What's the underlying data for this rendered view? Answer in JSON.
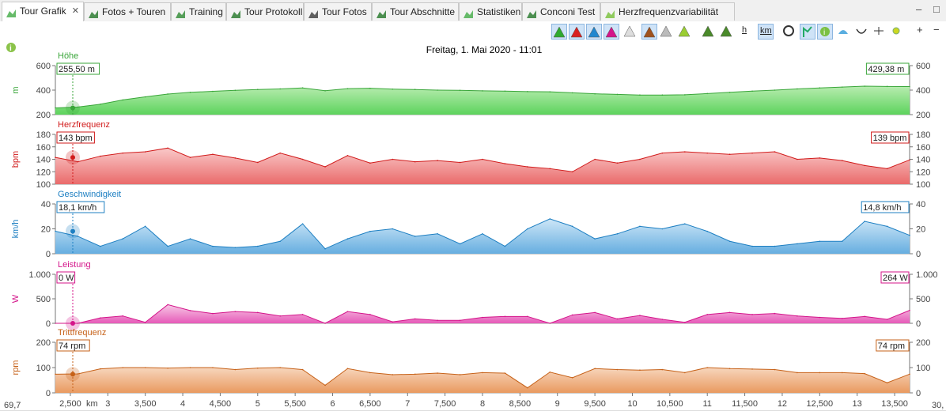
{
  "tabs": [
    {
      "label": "Tour Grafik",
      "icon": "chart-area-icon",
      "active": true,
      "closable": true
    },
    {
      "label": "Fotos + Touren",
      "icon": "photo-tour-icon"
    },
    {
      "label": "Training",
      "icon": "training-icon"
    },
    {
      "label": "Tour Protokoll",
      "icon": "protocol-icon"
    },
    {
      "label": "Tour Fotos",
      "icon": "camera-icon"
    },
    {
      "label": "Tour Abschnitte",
      "icon": "segments-icon"
    },
    {
      "label": "Statistiken",
      "icon": "statistics-icon"
    },
    {
      "label": "Conconi Test",
      "icon": "conconi-icon"
    },
    {
      "label": "Herzfrequenzvariabilität",
      "icon": "heart-icon"
    }
  ],
  "window_controls": {
    "minimize": "–",
    "maximize": "□"
  },
  "toolbar": {
    "plus": "+",
    "minus": "−",
    "tb_h": "h",
    "tb_km": "km"
  },
  "graph": {
    "title": "Freitag, 1. Mai 2020 - 11:01",
    "x_left_value": "69,7",
    "x_right_value": "30,",
    "x_unit": "km",
    "x_ticks": [
      "2,500",
      "3",
      "3,500",
      "4",
      "4,500",
      "5",
      "5,500",
      "6",
      "6,500",
      "7",
      "7,500",
      "8",
      "8,500",
      "9",
      "9,500",
      "10",
      "10,500",
      "11",
      "11,500",
      "12",
      "12,500",
      "13",
      "13,500"
    ],
    "panels": [
      {
        "key": "hoehe",
        "name": "Höhe",
        "unit": "m",
        "color": "#3aa63a",
        "fill_top": "#b8ecb0",
        "fill_bottom": "#5dd35d",
        "left_value": "255,50 m",
        "right_value": "429,38 m",
        "yticks": [
          "600",
          "400",
          "200"
        ],
        "ymin": 200,
        "ymax": 600
      },
      {
        "key": "herz",
        "name": "Herzfrequenz",
        "unit": "bpm",
        "color": "#d11b1b",
        "fill_top": "#f9c9c9",
        "fill_bottom": "#ea6b6b",
        "left_value": "143 bpm",
        "right_value": "139 bpm",
        "yticks": [
          "180",
          "160",
          "140",
          "120",
          "100"
        ],
        "ymin": 100,
        "ymax": 180
      },
      {
        "key": "speed",
        "name": "Geschwindigkeit",
        "unit": "km/h",
        "color": "#1d7fc2",
        "fill_top": "#cde6f7",
        "fill_bottom": "#66aee0",
        "left_value": "18,1 km/h",
        "right_value": "14,8 km/h",
        "yticks": [
          "40",
          "20",
          "0"
        ],
        "ymin": 0,
        "ymax": 40
      },
      {
        "key": "power",
        "name": "Leistung",
        "unit": "W",
        "color": "#d4158a",
        "fill_top": "#f7c8e6",
        "fill_bottom": "#e65ab8",
        "left_value": "0 W",
        "right_value": "264 W",
        "yticks": [
          "1.000",
          "500",
          "0"
        ],
        "ymin": 0,
        "ymax": 1000
      },
      {
        "key": "cadence",
        "name": "Trittfrequenz",
        "unit": "rpm",
        "color": "#c66118",
        "fill_top": "#f7d6bd",
        "fill_bottom": "#e99a60",
        "left_value": "74 rpm",
        "right_value": "74 rpm",
        "yticks": [
          "200",
          "100",
          "0"
        ],
        "ymin": 0,
        "ymax": 200
      }
    ]
  },
  "chart_data": {
    "type": "area",
    "title": "Freitag, 1. Mai 2020 - 11:01",
    "x": [
      2.3,
      2.6,
      2.9,
      3.2,
      3.5,
      3.8,
      4.1,
      4.4,
      4.7,
      5.0,
      5.3,
      5.6,
      5.9,
      6.2,
      6.5,
      6.8,
      7.1,
      7.4,
      7.7,
      8.0,
      8.3,
      8.6,
      8.9,
      9.2,
      9.5,
      9.8,
      10.1,
      10.4,
      10.7,
      11.0,
      11.3,
      11.6,
      11.9,
      12.2,
      12.5,
      12.8,
      13.1,
      13.4,
      13.7
    ],
    "xlim": [
      2.3,
      13.7
    ],
    "series": [
      {
        "name": "Höhe",
        "values": [
          255,
          262,
          285,
          320,
          345,
          368,
          382,
          390,
          398,
          405,
          410,
          418,
          395,
          412,
          415,
          408,
          405,
          400,
          398,
          394,
          392,
          388,
          386,
          378,
          370,
          365,
          360,
          360,
          362,
          372,
          382,
          392,
          400,
          410,
          418,
          425,
          432,
          430,
          429
        ]
      },
      {
        "name": "Herzfrequenz",
        "values": [
          143,
          136,
          145,
          150,
          152,
          158,
          143,
          148,
          142,
          135,
          150,
          140,
          128,
          146,
          134,
          140,
          136,
          138,
          135,
          140,
          133,
          128,
          125,
          120,
          140,
          134,
          140,
          150,
          152,
          150,
          148,
          150,
          152,
          140,
          142,
          138,
          130,
          125,
          139
        ]
      },
      {
        "name": "Geschwindigkeit",
        "values": [
          18.1,
          14,
          6,
          12,
          22,
          6,
          12,
          6,
          5,
          6,
          10,
          24,
          4,
          12,
          18,
          20,
          14,
          16,
          8,
          16,
          6,
          20,
          28,
          22,
          12,
          16,
          22,
          20,
          24,
          18,
          10,
          6,
          6,
          8,
          10,
          10,
          26,
          22,
          14.8
        ]
      },
      {
        "name": "Leistung",
        "values": [
          0,
          0,
          110,
          150,
          20,
          380,
          260,
          200,
          240,
          220,
          150,
          180,
          0,
          240,
          180,
          30,
          90,
          60,
          60,
          120,
          140,
          140,
          0,
          170,
          220,
          90,
          160,
          80,
          20,
          180,
          220,
          180,
          200,
          150,
          120,
          100,
          140,
          80,
          264
        ]
      },
      {
        "name": "Trittfrequenz",
        "values": [
          74,
          75,
          95,
          100,
          100,
          98,
          100,
          100,
          92,
          98,
          100,
          92,
          30,
          96,
          80,
          72,
          74,
          78,
          72,
          80,
          78,
          20,
          82,
          60,
          96,
          92,
          90,
          92,
          80,
          100,
          96,
          94,
          92,
          80,
          80,
          80,
          76,
          40,
          74
        ]
      }
    ]
  }
}
